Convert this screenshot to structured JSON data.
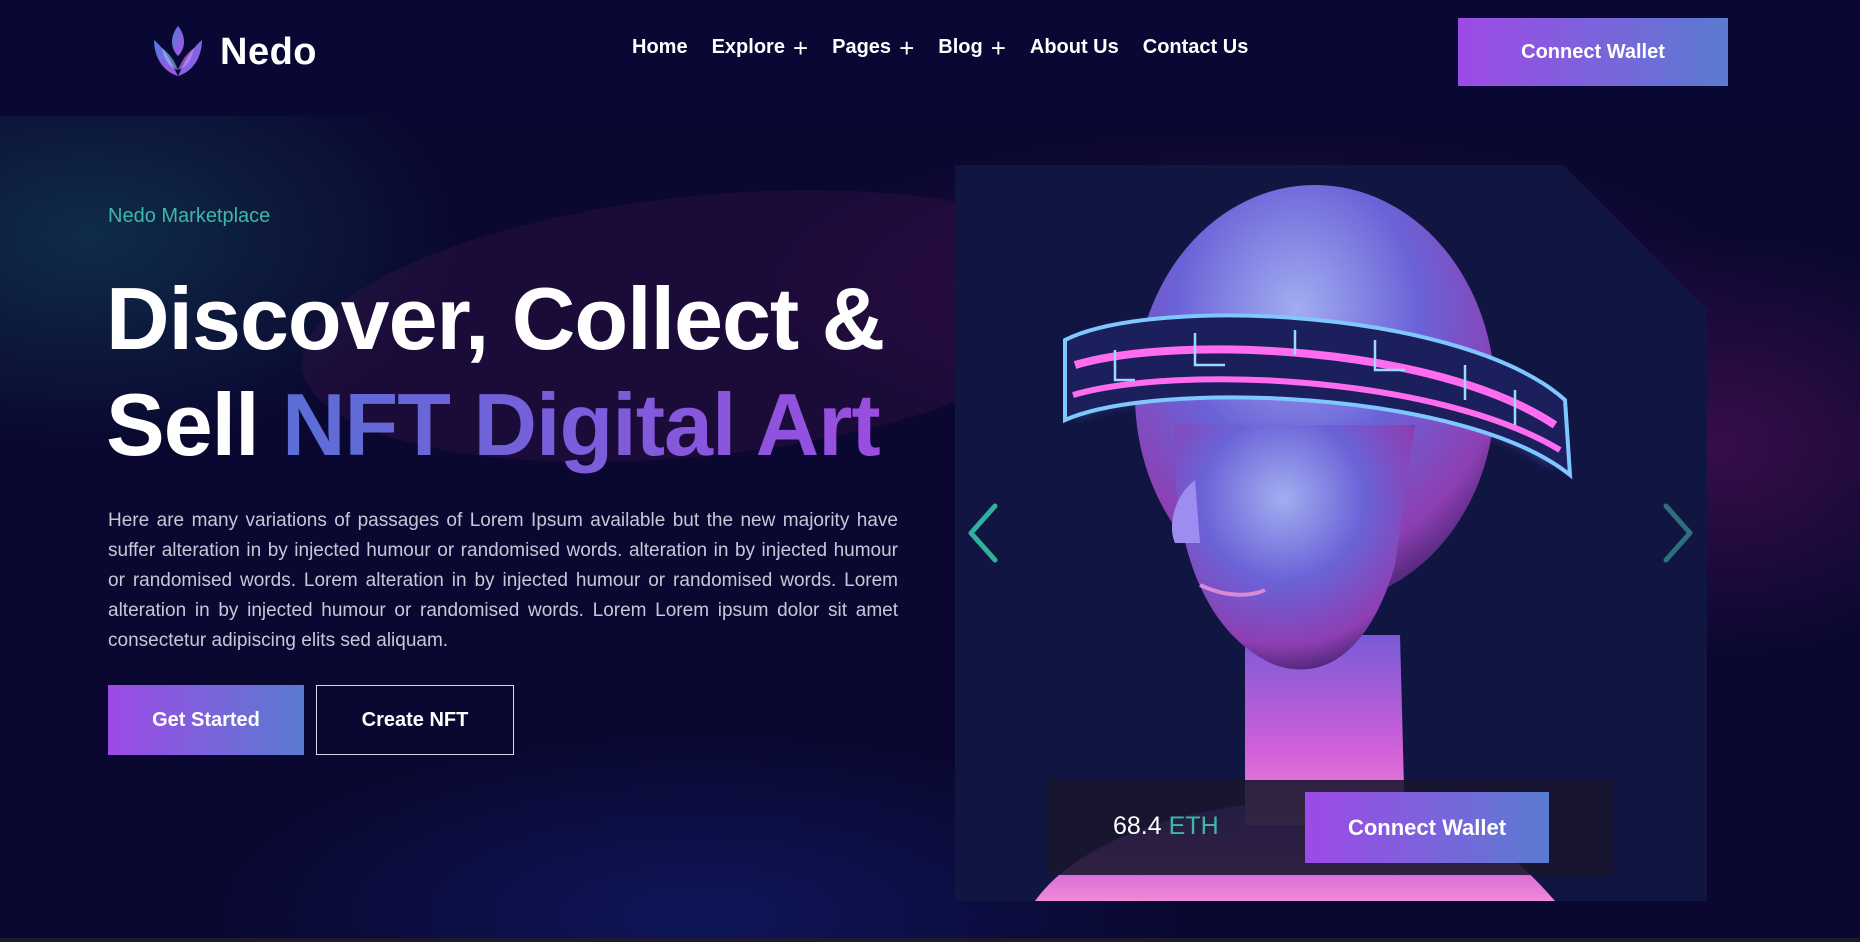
{
  "header": {
    "logo_text": "Nedo",
    "nav": [
      {
        "label": "Home",
        "has_submenu": false
      },
      {
        "label": "Explore",
        "has_submenu": true
      },
      {
        "label": "Pages",
        "has_submenu": true
      },
      {
        "label": "Blog",
        "has_submenu": true
      },
      {
        "label": "About Us",
        "has_submenu": false
      },
      {
        "label": "Contact Us",
        "has_submenu": false
      }
    ],
    "submenu_icon": "+",
    "cta_label": "Connect Wallet"
  },
  "hero": {
    "subtitle": "Nedo Marketplace",
    "headline_line1": "Discover, Collect &",
    "headline_line2_plain": "Sell",
    "headline_line2_accent": "NFT Digital Art",
    "description": "Here are many variations of passages of Lorem Ipsum available but the new majority have suffer alteration in by injected humour or randomised words. alteration in by injected humour or randomised words. Lorem alteration in by injected humour or randomised words. Lorem alteration in by injected humour or randomised words. Lorem Lorem ipsum dolor sit amet consectetur adipiscing elits sed aliquam.",
    "primary_button": "Get Started",
    "secondary_button": "Create NFT"
  },
  "slider": {
    "art_subject": "neon-vr-headset-mannequin",
    "prev_icon": "chevron-left-icon",
    "next_icon": "chevron-right-icon",
    "price_value": "68.4",
    "price_unit": "ETH",
    "button_label": "Connect Wallet"
  },
  "colors": {
    "background": "#0a0830",
    "header_bg": "#090733",
    "accent_teal": "#3bb8a8",
    "gradient_start": "#9e4ae6",
    "gradient_end": "#5a7bd1"
  }
}
